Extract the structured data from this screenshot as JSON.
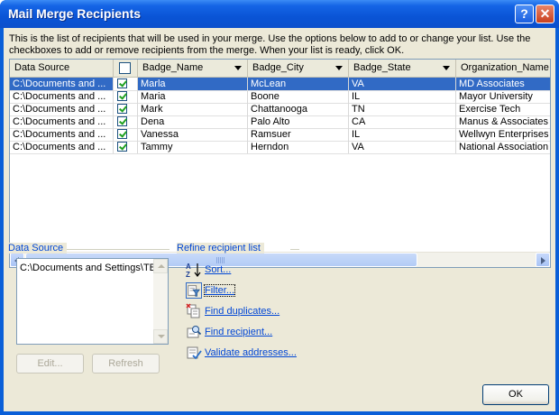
{
  "window": {
    "title": "Mail Merge Recipients",
    "help_label": "?",
    "close_label": "✕"
  },
  "description": "This is the list of recipients that will be used in your merge.  Use the options below to add to or change your list.  Use the checkboxes to add or remove recipients from the merge.  When your list is ready, click OK.",
  "grid": {
    "headers": [
      "Data Source",
      "",
      "Badge_Name",
      "Badge_City",
      "Badge_State",
      "Organization_Name"
    ],
    "rows": [
      {
        "source": "C:\\Documents and ...",
        "checked": true,
        "name": "Marla",
        "city": "McLean",
        "state": "VA",
        "org": "MD Associates",
        "selected": true
      },
      {
        "source": "C:\\Documents and ...",
        "checked": true,
        "name": "Maria",
        "city": "Boone",
        "state": "IL",
        "org": "Mayor University",
        "selected": false
      },
      {
        "source": "C:\\Documents and ...",
        "checked": true,
        "name": "Mark",
        "city": "Chattanooga",
        "state": "TN",
        "org": "Exercise Tech",
        "selected": false
      },
      {
        "source": "C:\\Documents and ...",
        "checked": true,
        "name": "Dena",
        "city": "Palo Alto",
        "state": "CA",
        "org": "Manus & Associates",
        "selected": false
      },
      {
        "source": "C:\\Documents and ...",
        "checked": true,
        "name": "Vanessa",
        "city": "Ramsuer",
        "state": "IL",
        "org": "Wellwyn Enterprises",
        "selected": false
      },
      {
        "source": "C:\\Documents and ...",
        "checked": true,
        "name": "Tammy",
        "city": "Herndon",
        "state": "VA",
        "org": "National Association o",
        "selected": false
      }
    ]
  },
  "data_source": {
    "label": "Data Source",
    "item": "C:\\Documents and Settings\\TB",
    "edit_label": "Edit...",
    "refresh_label": "Refresh"
  },
  "refine": {
    "label": "Refine recipient list",
    "links": [
      {
        "label": "Sort...",
        "icon": "sort-az-icon"
      },
      {
        "label": "Filter...",
        "icon": "filter-icon"
      },
      {
        "label": "Find duplicates...",
        "icon": "find-duplicates-icon"
      },
      {
        "label": "Find recipient...",
        "icon": "find-recipient-icon"
      },
      {
        "label": "Validate addresses...",
        "icon": "validate-addresses-icon"
      }
    ]
  },
  "ok_label": "OK",
  "colors": {
    "title_blue": "#0a54d6",
    "selection": "#316ac5",
    "link": "#0046d5",
    "face": "#ece9d8"
  }
}
